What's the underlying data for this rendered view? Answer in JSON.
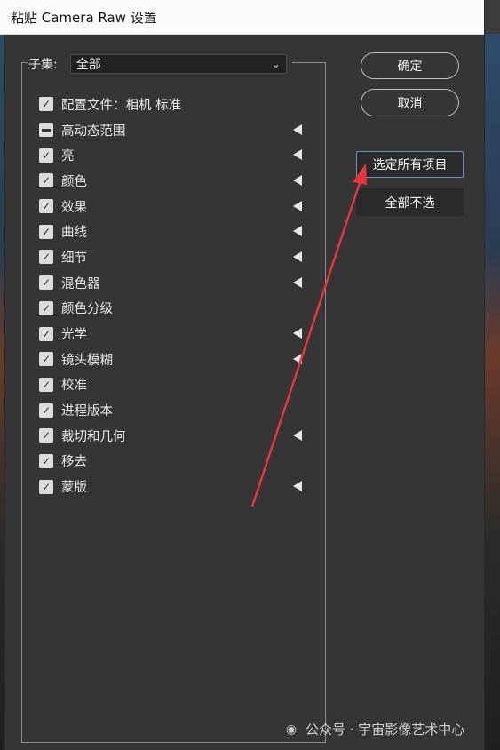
{
  "window": {
    "title": "粘贴 Camera Raw 设置"
  },
  "subset": {
    "label": "子集:",
    "selected": "全部"
  },
  "items": [
    {
      "label": "配置文件：相机  标准",
      "state": "checked",
      "has_submenu": false
    },
    {
      "label": "高动态范围",
      "state": "partial",
      "has_submenu": true
    },
    {
      "label": "亮",
      "state": "checked",
      "has_submenu": true
    },
    {
      "label": "颜色",
      "state": "checked",
      "has_submenu": true
    },
    {
      "label": "效果",
      "state": "checked",
      "has_submenu": true
    },
    {
      "label": "曲线",
      "state": "checked",
      "has_submenu": true
    },
    {
      "label": "细节",
      "state": "checked",
      "has_submenu": true
    },
    {
      "label": "混色器",
      "state": "checked",
      "has_submenu": true
    },
    {
      "label": "颜色分级",
      "state": "checked",
      "has_submenu": false
    },
    {
      "label": "光学",
      "state": "checked",
      "has_submenu": true
    },
    {
      "label": "镜头模糊",
      "state": "checked",
      "has_submenu": true
    },
    {
      "label": "校准",
      "state": "checked",
      "has_submenu": false
    },
    {
      "label": "进程版本",
      "state": "checked",
      "has_submenu": false
    },
    {
      "label": "裁切和几何",
      "state": "checked",
      "has_submenu": true
    },
    {
      "label": "移去",
      "state": "checked",
      "has_submenu": false
    },
    {
      "label": "蒙版",
      "state": "checked",
      "has_submenu": true
    }
  ],
  "buttons": {
    "ok": "确定",
    "cancel": "取消",
    "select_all": "选定所有项目",
    "select_none": "全部不选"
  },
  "watermark": {
    "text": "公众号 · 宇宙影像艺术中心"
  },
  "colors": {
    "arrow": "#e8343a",
    "focus_border": "#6d8fc4"
  }
}
